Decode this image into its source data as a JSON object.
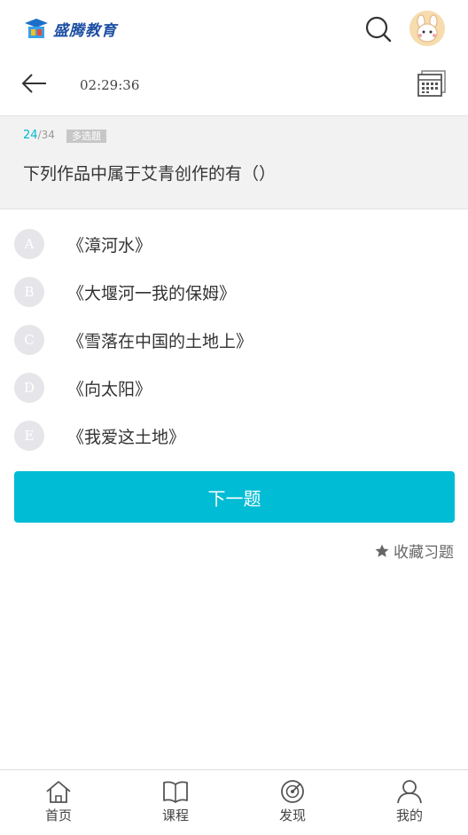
{
  "header": {
    "logo_text": "盛腾教育"
  },
  "subheader": {
    "timer": "02:29:36"
  },
  "question": {
    "current": "24",
    "total": "/34",
    "type": "多选题",
    "text": "下列作品中属于艾青创作的有（）"
  },
  "options": [
    {
      "letter": "A",
      "text": "《漳河水》"
    },
    {
      "letter": "B",
      "text": "《大堰河一我的保姆》"
    },
    {
      "letter": "C",
      "text": "《雪落在中国的土地上》"
    },
    {
      "letter": "D",
      "text": "《向太阳》"
    },
    {
      "letter": "E",
      "text": "《我爱这土地》"
    }
  ],
  "actions": {
    "next_label": "下一题",
    "favorite_label": "收藏习题"
  },
  "nav": [
    {
      "label": "首页",
      "icon": "home-icon"
    },
    {
      "label": "课程",
      "icon": "book-icon"
    },
    {
      "label": "发现",
      "icon": "discover-icon"
    },
    {
      "label": "我的",
      "icon": "user-icon"
    }
  ],
  "colors": {
    "accent": "#00bcd4",
    "logo": "#1c4fa3",
    "option_circle": "#e6e6ea"
  }
}
